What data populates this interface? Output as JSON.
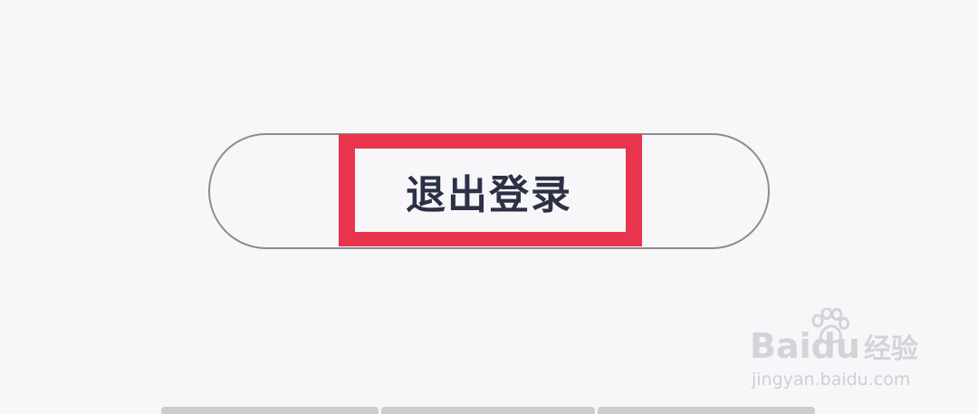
{
  "logout_button": {
    "label": "退出登录"
  },
  "watermark": {
    "brand": "Bai",
    "brand_suffix": "du",
    "brand_cn": "经验",
    "url": "jingyan.baidu.com",
    "icon": "paw-icon"
  },
  "colors": {
    "background": "#f7f6f9",
    "button_border": "#8c8c8e",
    "label_text": "#2c3146",
    "highlight": "#e8344c",
    "watermark": "#d4d4d8",
    "bottom_bar": "#cdcdd0"
  }
}
